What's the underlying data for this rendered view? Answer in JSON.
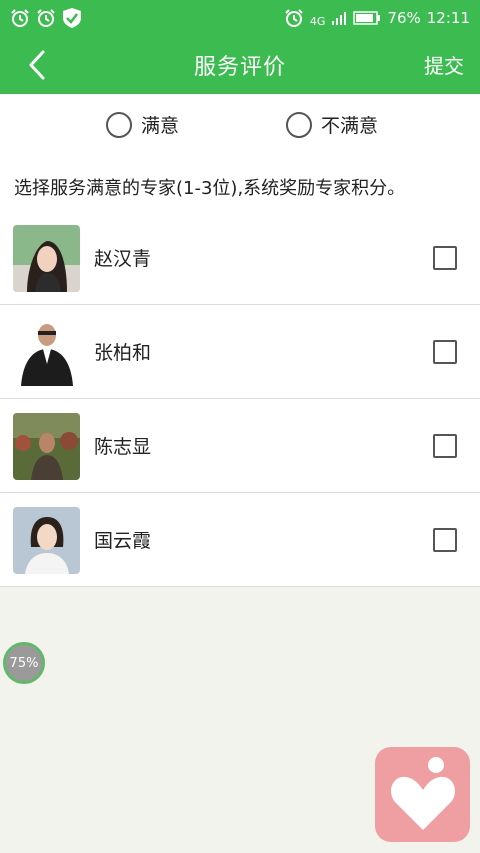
{
  "status_bar": {
    "network": "4G",
    "battery": "76%",
    "time": "12:11"
  },
  "header": {
    "title": "服务评价",
    "submit_label": "提交"
  },
  "rating": {
    "options": [
      {
        "label": "满意",
        "selected": false
      },
      {
        "label": "不满意",
        "selected": false
      }
    ]
  },
  "instruction": "选择服务满意的专家(1-3位),系统奖励专家积分。",
  "experts": [
    {
      "name": "赵汉青",
      "checked": false
    },
    {
      "name": "张柏和",
      "checked": false
    },
    {
      "name": "陈志显",
      "checked": false
    },
    {
      "name": "国云霞",
      "checked": false
    }
  ],
  "floating": {
    "progress": "75%"
  },
  "colors": {
    "primary_green": "#3cbc50",
    "app_button_pink": "#ef9ea2"
  }
}
